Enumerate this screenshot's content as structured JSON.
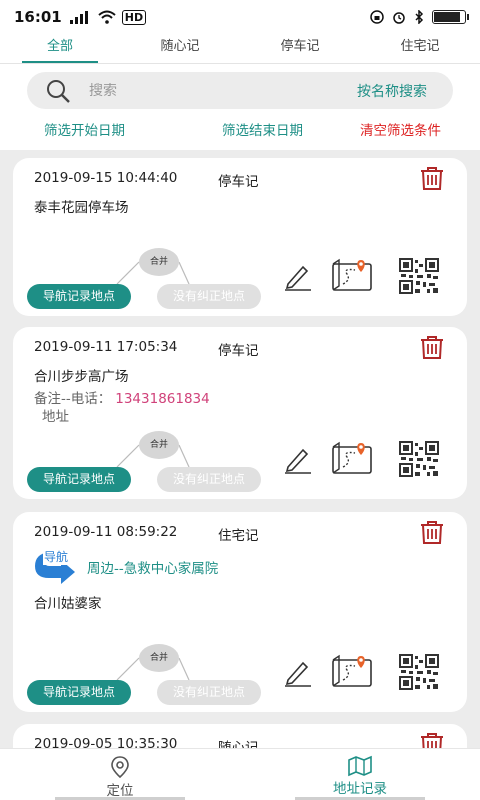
{
  "status_bar": {
    "time": "16:01",
    "net_type": "HD",
    "battery_level": 0.9
  },
  "tabs": [
    {
      "label": "全部",
      "active": true
    },
    {
      "label": "随心记",
      "active": false
    },
    {
      "label": "停车记",
      "active": false
    },
    {
      "label": "住宅记",
      "active": false
    }
  ],
  "search": {
    "placeholder": "搜索",
    "button_label": "按名称搜索"
  },
  "filters": {
    "start_label": "筛选开始日期",
    "end_label": "筛选结束日期",
    "clear_label": "清空筛选条件"
  },
  "cards": [
    {
      "datetime": "2019-09-15 10:44:40",
      "category": "停车记",
      "name": "泰丰花园停车场",
      "merge_label": "合并",
      "nav_button": "导航记录地点",
      "unfixed_button": "没有纠正地点"
    },
    {
      "datetime": "2019-09-11 17:05:34",
      "category": "停车记",
      "name": "合川步步高广场",
      "note_prefix": "备注--电话：",
      "phone": "13431861834",
      "address": "地址",
      "merge_label": "合并",
      "nav_button": "导航记录地点",
      "unfixed_button": "没有纠正地点"
    },
    {
      "datetime": "2019-09-11 08:59:22",
      "category": "住宅记",
      "nav_badge": "导航",
      "nav_text": "周边--急救中心家属院",
      "name": "合川姑婆家",
      "merge_label": "合并",
      "nav_button": "导航记录地点",
      "unfixed_button": "没有纠正地点"
    },
    {
      "datetime": "2019-09-05 10:35:30",
      "category": "随心记"
    }
  ],
  "bottom_nav": {
    "locate_label": "定位",
    "records_label": "地址记录"
  },
  "colors": {
    "accent": "#1e8f86",
    "danger": "#d22222",
    "phone": "#d0427a",
    "trash": "#b02828"
  }
}
